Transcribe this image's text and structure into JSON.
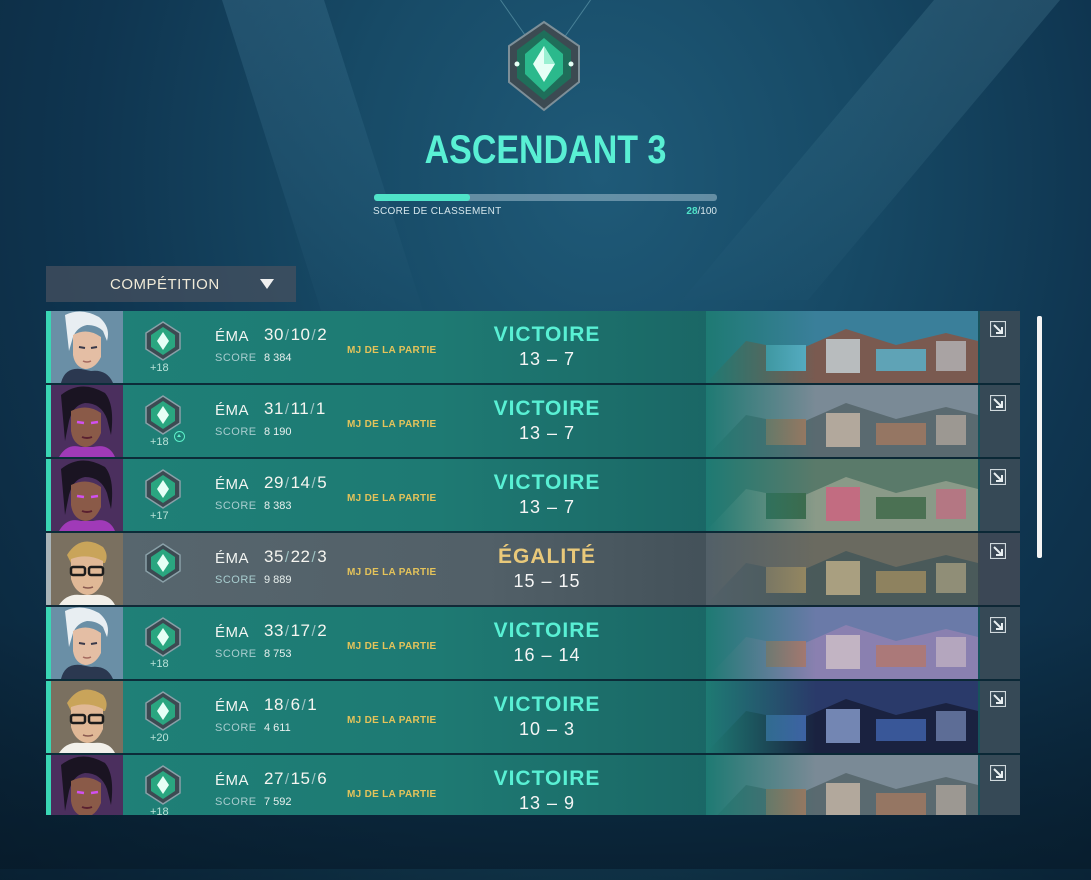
{
  "rank": {
    "name": "ASCENDANT 3",
    "rr_label": "SCORE DE CLASSEMENT",
    "rr_current": "28",
    "rr_max": "/100",
    "rr_fraction": 0.28,
    "accent_color": "#59f0d4"
  },
  "mode_select": {
    "label": "COMPÉTITION",
    "icon": "dropdown-triangle-icon"
  },
  "matches": [
    {
      "rr": "+18",
      "map": "ÉMA",
      "k": "30",
      "d": "10",
      "a": "2",
      "score_label": "SCORE",
      "score": "8 384",
      "mvp": "MJ DE LA PARTIE",
      "result": "VICTOIRE",
      "rounds": "13 – 7",
      "rank_up": false,
      "portrait": "jett",
      "map_theme": "coastal-city"
    },
    {
      "rr": "+18",
      "map": "ÉMA",
      "k": "31",
      "d": "11",
      "a": "1",
      "score_label": "SCORE",
      "score": "8 190",
      "mvp": "MJ DE LA PARTIE",
      "result": "VICTOIRE",
      "rounds": "13 – 7",
      "rank_up": true,
      "portrait": "reyna",
      "map_theme": "town"
    },
    {
      "rr": "+17",
      "map": "ÉMA",
      "k": "29",
      "d": "14",
      "a": "5",
      "score_label": "SCORE",
      "score": "8 383",
      "mvp": "MJ DE LA PARTIE",
      "result": "VICTOIRE",
      "rounds": "13 – 7",
      "rank_up": false,
      "portrait": "reyna",
      "map_theme": "jungle"
    },
    {
      "rr": "",
      "map": "ÉMA",
      "k": "35",
      "d": "22",
      "a": "3",
      "score_label": "SCORE",
      "score": "9 889",
      "mvp": "MJ DE LA PARTIE",
      "result": "ÉGALITÉ",
      "rounds": "15 – 15",
      "rank_up": false,
      "portrait": "chamber",
      "map_theme": "warehouse",
      "draw": true
    },
    {
      "rr": "+18",
      "map": "ÉMA",
      "k": "33",
      "d": "17",
      "a": "2",
      "score_label": "SCORE",
      "score": "8 753",
      "mvp": "MJ DE LA PARTIE",
      "result": "VICTOIRE",
      "rounds": "16 – 14",
      "rank_up": false,
      "portrait": "jett",
      "map_theme": "courtyard"
    },
    {
      "rr": "+20",
      "map": "ÉMA",
      "k": "18",
      "d": "6",
      "a": "1",
      "score_label": "SCORE",
      "score": "4 611",
      "mvp": "MJ DE LA PARTIE",
      "result": "VICTOIRE",
      "rounds": "10 – 3",
      "rank_up": false,
      "portrait": "chamber",
      "map_theme": "night-city"
    },
    {
      "rr": "+18",
      "map": "ÉMA",
      "k": "27",
      "d": "15",
      "a": "6",
      "score_label": "SCORE",
      "score": "7 592",
      "mvp": "MJ DE LA PARTIE",
      "result": "VICTOIRE",
      "rounds": "13 – 9",
      "rank_up": false,
      "portrait": "reyna",
      "map_theme": "town"
    }
  ]
}
